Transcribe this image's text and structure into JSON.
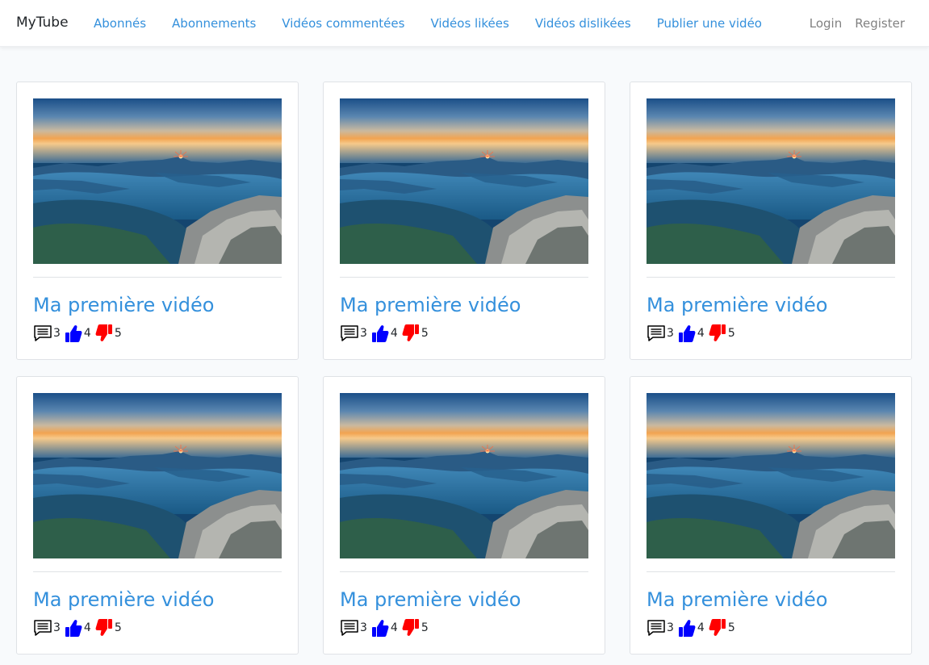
{
  "navbar": {
    "brand": "MyTube",
    "links": [
      "Abonnés",
      "Abonnements",
      "Vidéos commentées",
      "Vidéos likées",
      "Vidéos dislikées",
      "Publier une vidéo"
    ],
    "auth": [
      "Login",
      "Register"
    ]
  },
  "videos": [
    {
      "title": "Ma première vidéo",
      "comments": "3",
      "likes": "4",
      "dislikes": "5"
    },
    {
      "title": "Ma première vidéo",
      "comments": "3",
      "likes": "4",
      "dislikes": "5"
    },
    {
      "title": "Ma première vidéo",
      "comments": "3",
      "likes": "4",
      "dislikes": "5"
    },
    {
      "title": "Ma première vidéo",
      "comments": "3",
      "likes": "4",
      "dislikes": "5"
    },
    {
      "title": "Ma première vidéo",
      "comments": "3",
      "likes": "4",
      "dislikes": "5"
    },
    {
      "title": "Ma première vidéo",
      "comments": "3",
      "likes": "4",
      "dislikes": "5"
    }
  ],
  "icons": {
    "comment": "comment-icon",
    "like": "thumbs-up-icon",
    "dislike": "thumbs-down-icon"
  },
  "colors": {
    "link": "#3490dc",
    "like": "#0000ff",
    "dislike": "#ff0000"
  }
}
